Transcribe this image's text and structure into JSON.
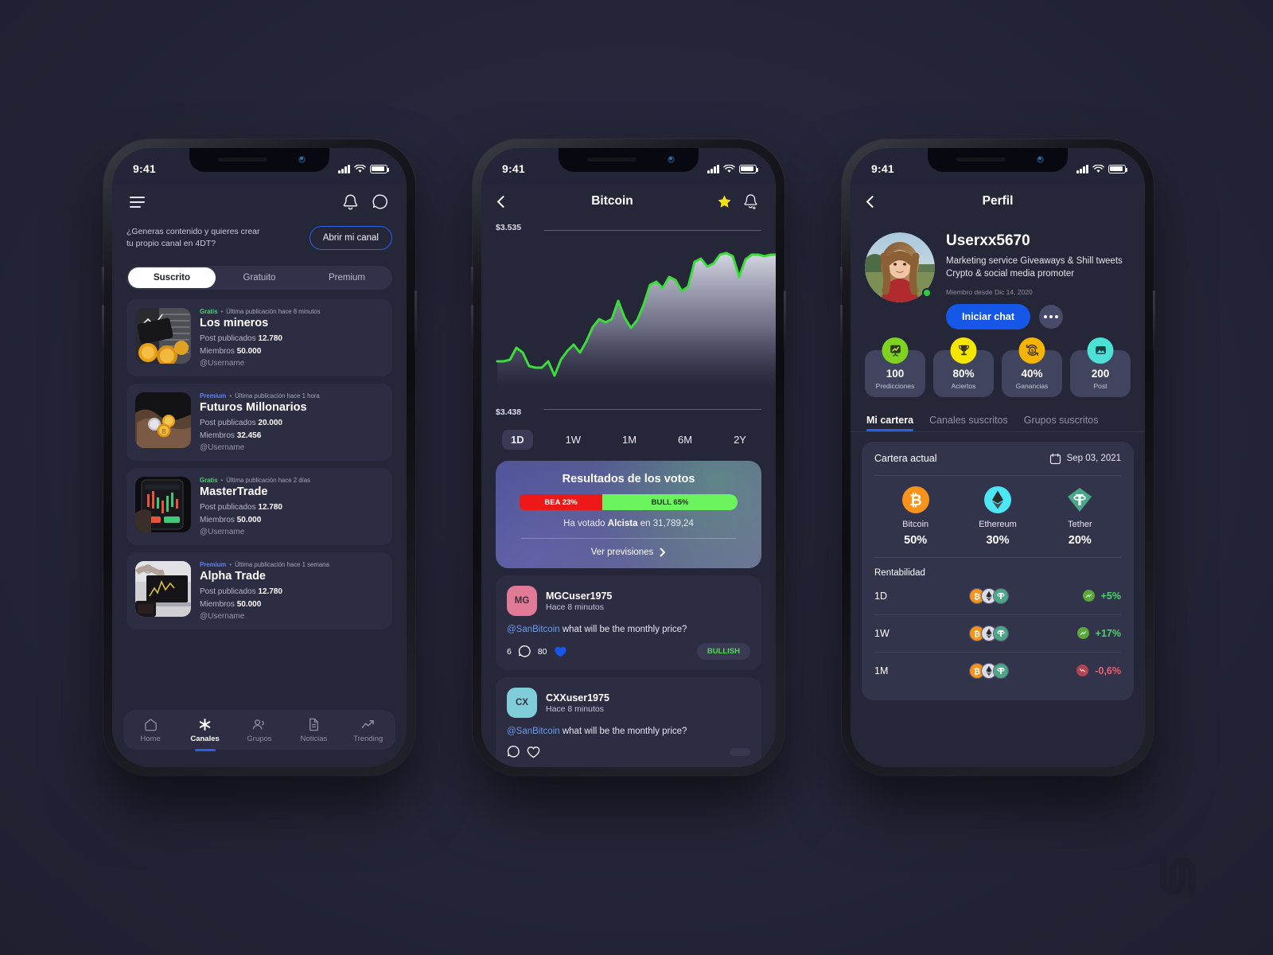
{
  "canvas": {
    "bg": "#262639",
    "accent": "#2563eb"
  },
  "phone1": {
    "status": {
      "time": "9:41"
    },
    "header": {
      "menu_icon": "hamburger-icon",
      "bell_icon": "bell-icon",
      "chat_icon": "chat-bubble-icon"
    },
    "promo": {
      "text": "¿Generas contenido y quieres crear tu propio canal en 4DT?",
      "button": "Abrir mi canal"
    },
    "segments": [
      {
        "label": "Suscrito",
        "active": true
      },
      {
        "label": "Gratuito",
        "active": false
      },
      {
        "label": "Premium",
        "active": false
      }
    ],
    "channels": [
      {
        "tag": "Gratis",
        "tag_type": "gratis",
        "meta": "Última publicación hace 8 minutos",
        "name": "Los mineros",
        "posts_label": "Post publicados",
        "posts_value": "12.780",
        "members_label": "Miembros",
        "members_value": "50.000",
        "username": "@Usernamе"
      },
      {
        "tag": "Premium",
        "tag_type": "premium",
        "meta": "Última publicación hace 1 hora",
        "name": "Futuros Millonarios",
        "posts_label": "Post publicados",
        "posts_value": "20.000",
        "members_label": "Miembros",
        "members_value": "32.456",
        "username": "@Usernamе"
      },
      {
        "tag": "Gratis",
        "tag_type": "gratis",
        "meta": "Última publicación hace 2 días",
        "name": "MasterTrade",
        "posts_label": "Post publicados",
        "posts_value": "12.780",
        "members_label": "Miembros",
        "members_value": "50.000",
        "username": "@Usernamе"
      },
      {
        "tag": "Premium",
        "tag_type": "premium",
        "meta": "Última publicación hace 1 semana",
        "name": "Alpha Trade",
        "posts_label": "Post publicados",
        "posts_value": "12.780",
        "members_label": "Miembros",
        "members_value": "50.000",
        "username": "@Usernamе"
      }
    ],
    "tabbar": [
      {
        "label": "Home",
        "icon": "home-icon",
        "active": false
      },
      {
        "label": "Canales",
        "icon": "asterisk-icon",
        "active": true
      },
      {
        "label": "Grupos",
        "icon": "people-icon",
        "active": false
      },
      {
        "label": "Noticias",
        "icon": "document-icon",
        "active": false
      },
      {
        "label": "Trending",
        "icon": "trending-up-icon",
        "active": false
      }
    ]
  },
  "phone2": {
    "status": {
      "time": "9:41"
    },
    "navbar": {
      "title": "Bitcoin",
      "back_icon": "back-chevron-icon",
      "star_icon": "star-icon",
      "bell_icon": "bell-add-icon"
    },
    "ranges": [
      {
        "label": "1D",
        "active": true
      },
      {
        "label": "1W",
        "active": false
      },
      {
        "label": "1M",
        "active": false
      },
      {
        "label": "6M",
        "active": false
      },
      {
        "label": "2Y",
        "active": false
      }
    ],
    "votes": {
      "title": "Resultados de los votos",
      "bear_label": "BEA 23%",
      "bull_label": "BULL 65%",
      "bear_pct": 23,
      "bull_pct": 65,
      "voted_prefix": "Ha votado",
      "voted_strong": "Alcista",
      "voted_suffix": "en 31,789,24",
      "link": "Ver previsiones"
    },
    "comments": [
      {
        "initials": "MG",
        "avatar_color": "#e07a96",
        "name": "MGCuser1975",
        "time": "Hace 8 minutos",
        "mention": "@SanBitcoin",
        "text": " what will be the monthly price?",
        "comments_count": "6",
        "likes_count": "80",
        "badge": "BULLISH"
      },
      {
        "initials": "CX",
        "avatar_color": "#7fcdd8",
        "name": "CXXuser1975",
        "time": "Hace 8 minutos",
        "mention": "@SanBitcoin",
        "text": " what will be the monthly price?",
        "comments_count": "",
        "likes_count": "",
        "badge": ""
      }
    ],
    "chart_data": {
      "type": "area",
      "title": "Bitcoin",
      "xlabel": "",
      "ylabel": "",
      "ylim": [
        3438,
        3535
      ],
      "ytick_labels": [
        "$3.535",
        "$3.438"
      ],
      "grid": true,
      "legend": null,
      "line_color": "#3ddc3d",
      "fill": "gradient-white-transparent",
      "x": [
        0,
        1,
        2,
        3,
        4,
        5,
        6,
        7,
        8,
        9,
        10,
        11,
        12,
        13,
        14,
        15,
        16,
        17,
        18,
        19,
        20,
        21,
        22,
        23,
        24,
        25,
        26,
        27,
        28,
        29,
        30,
        31,
        32,
        33,
        34,
        35,
        36,
        37,
        38,
        39,
        40
      ],
      "values": [
        3456,
        3456,
        3457,
        3465,
        3462,
        3453,
        3452,
        3452,
        3456,
        3450,
        3457,
        3463,
        3467,
        3462,
        3469,
        3478,
        3483,
        3481,
        3483,
        3495,
        3484,
        3477,
        3482,
        3492,
        3505,
        3507,
        3503,
        3510,
        3508,
        3501,
        3504,
        3517,
        3519,
        3514,
        3516,
        3522,
        3523,
        3521,
        3508,
        3519,
        3522
      ]
    }
  },
  "phone3": {
    "status": {
      "time": "9:41"
    },
    "navbar": {
      "title": "Perfil",
      "back_icon": "back-chevron-icon"
    },
    "profile": {
      "name": "Userxx5670",
      "bio": "Marketing service  Giveaways & Shill tweets Crypto & social media promoter",
      "member_since": "Miembro desde Dic 14, 2020",
      "chat_button": "Iniciar chat",
      "more_button": "more-options-icon",
      "online": true
    },
    "stats": [
      {
        "value": "100",
        "label": "Predicciones",
        "icon": "chart-board-icon",
        "color": "#7ed321"
      },
      {
        "value": "80%",
        "label": "Aciertos",
        "icon": "trophy-icon",
        "color": "#f5e600"
      },
      {
        "value": "40%",
        "label": "Ganancias",
        "icon": "money-refresh-icon",
        "color": "#f5b400"
      },
      {
        "value": "200",
        "label": "Post",
        "icon": "image-icon",
        "color": "#4de0d6"
      }
    ],
    "tabs": [
      {
        "label": "Mi cartera",
        "active": true
      },
      {
        "label": "Canales suscritos",
        "active": false
      },
      {
        "label": "Grupos suscritos",
        "active": false
      }
    ],
    "wallet": {
      "title": "Cartera actual",
      "date": "Sep 03, 2021",
      "calendar_icon": "calendar-icon",
      "coins": [
        {
          "name": "Bitcoin",
          "pct": "50%",
          "icon": "bitcoin-icon"
        },
        {
          "name": "Ethereum",
          "pct": "30%",
          "icon": "ethereum-icon"
        },
        {
          "name": "Tether",
          "pct": "20%",
          "icon": "tether-icon"
        }
      ],
      "rent_title": "Rentabilidad",
      "rows": [
        {
          "period": "1D",
          "value": "+5%",
          "dir": "up"
        },
        {
          "period": "1W",
          "value": "+17%",
          "dir": "up"
        },
        {
          "period": "1M",
          "value": "-0,6%",
          "dir": "down"
        }
      ]
    }
  }
}
